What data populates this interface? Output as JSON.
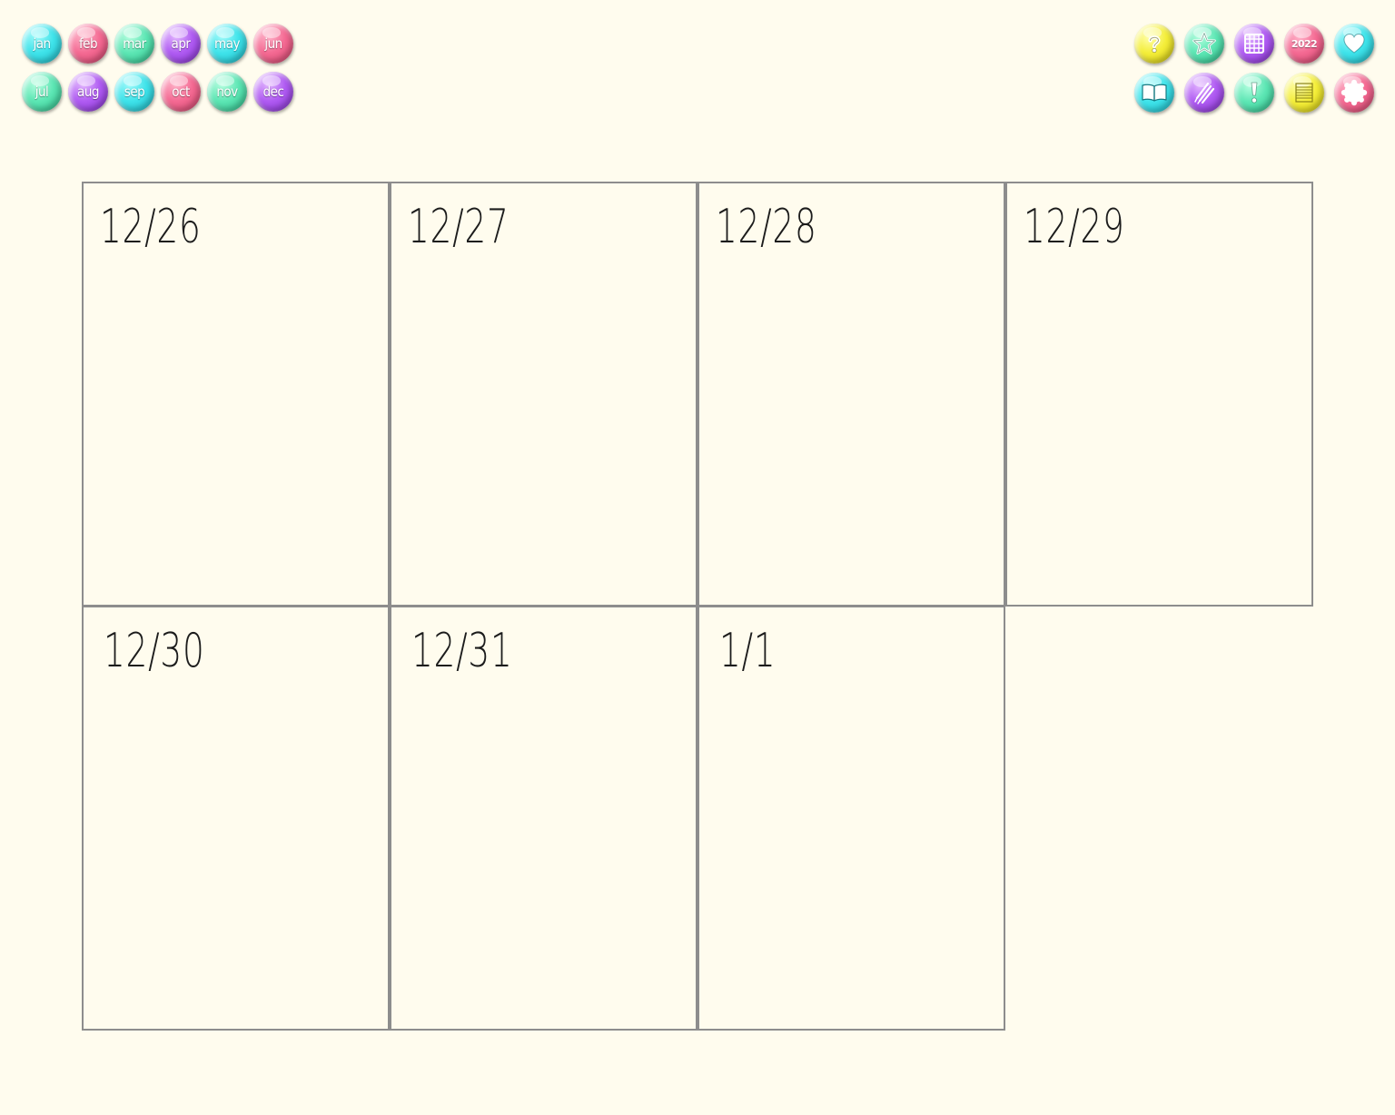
{
  "months": {
    "row1": [
      {
        "label": "jan",
        "color": "#3fe3ea"
      },
      {
        "label": "feb",
        "color": "#f46a93"
      },
      {
        "label": "mar",
        "color": "#5de6b4"
      },
      {
        "label": "apr",
        "color": "#b05cf2"
      },
      {
        "label": "may",
        "color": "#3fe3ea"
      },
      {
        "label": "jun",
        "color": "#f46a93"
      }
    ],
    "row2": [
      {
        "label": "jul",
        "color": "#5de6b4"
      },
      {
        "label": "aug",
        "color": "#b05cf2"
      },
      {
        "label": "sep",
        "color": "#3fe3ea"
      },
      {
        "label": "oct",
        "color": "#f46a93"
      },
      {
        "label": "nov",
        "color": "#5de6b4"
      },
      {
        "label": "dec",
        "color": "#b05cf2"
      }
    ]
  },
  "tools": {
    "row1": [
      {
        "icon": "question-icon",
        "color": "#f4ee3a"
      },
      {
        "icon": "star-icon",
        "color": "#5de6b4"
      },
      {
        "icon": "calendar-grid-icon",
        "color": "#b05cf2"
      },
      {
        "icon": "year-badge",
        "label": "2022",
        "color": "#f46a93"
      },
      {
        "icon": "heart-icon",
        "color": "#3fe3ea"
      }
    ],
    "row2": [
      {
        "icon": "book-icon",
        "color": "#3fe3ea"
      },
      {
        "icon": "pencils-icon",
        "color": "#b05cf2"
      },
      {
        "icon": "exclamation-icon",
        "color": "#5de6b4"
      },
      {
        "icon": "notepad-icon",
        "color": "#f4ee3a"
      },
      {
        "icon": "scalloped-circle-icon",
        "color": "#f46a93"
      }
    ]
  },
  "calendar": {
    "days": [
      {
        "date": "12/26"
      },
      {
        "date": "12/27"
      },
      {
        "date": "12/28"
      },
      {
        "date": "12/29"
      },
      {
        "date": "12/30"
      },
      {
        "date": "12/31"
      },
      {
        "date": "1/1"
      }
    ]
  },
  "colors": {
    "background": "#fffcee",
    "grid_line": "#8d8d8d",
    "date_text": "#1c1c1c"
  }
}
